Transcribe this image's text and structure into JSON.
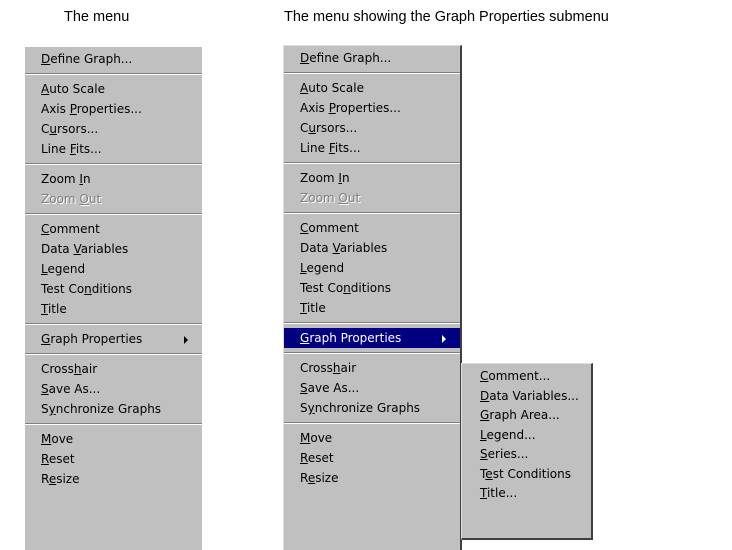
{
  "captions": {
    "left": "The menu",
    "right": "The menu showing the Graph Properties submenu"
  },
  "menu": {
    "groups": [
      [
        {
          "id": "define-graph",
          "pre": "",
          "key": "D",
          "post": "efine Graph...",
          "enabled": true
        }
      ],
      [
        {
          "id": "auto-scale",
          "pre": "",
          "key": "A",
          "post": "uto Scale",
          "enabled": true
        },
        {
          "id": "axis-properties",
          "pre": "Axis ",
          "key": "P",
          "post": "roperties...",
          "enabled": true
        },
        {
          "id": "cursors",
          "pre": "C",
          "key": "u",
          "post": "rsors...",
          "enabled": true
        },
        {
          "id": "line-fits",
          "pre": "Line ",
          "key": "F",
          "post": "its...",
          "enabled": true
        }
      ],
      [
        {
          "id": "zoom-in",
          "pre": "Zoom ",
          "key": "I",
          "post": "n",
          "enabled": true
        },
        {
          "id": "zoom-out",
          "pre": "Zoom ",
          "key": "O",
          "post": "ut",
          "enabled": false
        }
      ],
      [
        {
          "id": "comment",
          "pre": "",
          "key": "C",
          "post": "omment",
          "enabled": true
        },
        {
          "id": "data-variables",
          "pre": "Data ",
          "key": "V",
          "post": "ariables",
          "enabled": true
        },
        {
          "id": "legend",
          "pre": "",
          "key": "L",
          "post": "egend",
          "enabled": true
        },
        {
          "id": "test-conditions",
          "pre": "Test Co",
          "key": "n",
          "post": "ditions",
          "enabled": true
        },
        {
          "id": "title",
          "pre": "",
          "key": "T",
          "post": "itle",
          "enabled": true
        }
      ],
      [
        {
          "id": "graph-properties",
          "pre": "",
          "key": "G",
          "post": "raph Properties",
          "enabled": true,
          "submenu": true
        }
      ],
      [
        {
          "id": "crosshair",
          "pre": "Cross",
          "key": "h",
          "post": "air",
          "enabled": true
        },
        {
          "id": "save-as",
          "pre": "",
          "key": "S",
          "post": "ave As...",
          "enabled": true
        },
        {
          "id": "synchronize-graphs",
          "pre": "S",
          "key": "y",
          "post": "nchronize Graphs",
          "enabled": true
        }
      ],
      [
        {
          "id": "move",
          "pre": "",
          "key": "M",
          "post": "ove",
          "enabled": true
        },
        {
          "id": "reset",
          "pre": "",
          "key": "R",
          "post": "eset",
          "enabled": true
        },
        {
          "id": "resize",
          "pre": "R",
          "key": "e",
          "post": "size",
          "enabled": true
        }
      ]
    ]
  },
  "submenu": {
    "items": [
      {
        "id": "comment",
        "pre": "",
        "key": "C",
        "post": "omment...",
        "enabled": true
      },
      {
        "id": "data-variables",
        "pre": "",
        "key": "D",
        "post": "ata Variables...",
        "enabled": true
      },
      {
        "id": "graph-area",
        "pre": "",
        "key": "G",
        "post": "raph Area...",
        "enabled": true
      },
      {
        "id": "legend",
        "pre": "",
        "key": "L",
        "post": "egend...",
        "enabled": true
      },
      {
        "id": "series",
        "pre": "",
        "key": "S",
        "post": "eries...",
        "enabled": true
      },
      {
        "id": "test-conditions",
        "pre": "T",
        "key": "e",
        "post": "st Conditions",
        "enabled": true
      },
      {
        "id": "title",
        "pre": "",
        "key": "T",
        "post": "itle...",
        "enabled": true
      }
    ]
  },
  "state": {
    "right_selected_item": "graph-properties"
  },
  "colors": {
    "menu_bg": "#c0c0c0",
    "highlight_bg": "#000080",
    "highlight_text": "#ffffff",
    "disabled_text": "#808080"
  }
}
